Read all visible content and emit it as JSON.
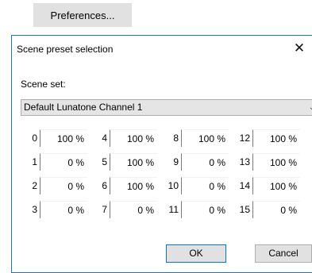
{
  "preferences_button": "Preferences...",
  "dialog": {
    "title": "Scene preset selection",
    "scene_set_label": "Scene set:",
    "scene_set_value": "Default Lunatone Channel 1",
    "ok_label": "OK",
    "cancel_label": "Cancel",
    "scenes": [
      {
        "index": "0",
        "value": "100 %"
      },
      {
        "index": "1",
        "value": "0 %"
      },
      {
        "index": "2",
        "value": "0 %"
      },
      {
        "index": "3",
        "value": "0 %"
      },
      {
        "index": "4",
        "value": "100 %"
      },
      {
        "index": "5",
        "value": "100 %"
      },
      {
        "index": "6",
        "value": "100 %"
      },
      {
        "index": "7",
        "value": "0 %"
      },
      {
        "index": "8",
        "value": "100 %"
      },
      {
        "index": "9",
        "value": "0 %"
      },
      {
        "index": "10",
        "value": "0 %"
      },
      {
        "index": "11",
        "value": "0 %"
      },
      {
        "index": "12",
        "value": "100 %"
      },
      {
        "index": "13",
        "value": "100 %"
      },
      {
        "index": "14",
        "value": "100 %"
      },
      {
        "index": "15",
        "value": "0 %"
      }
    ]
  }
}
